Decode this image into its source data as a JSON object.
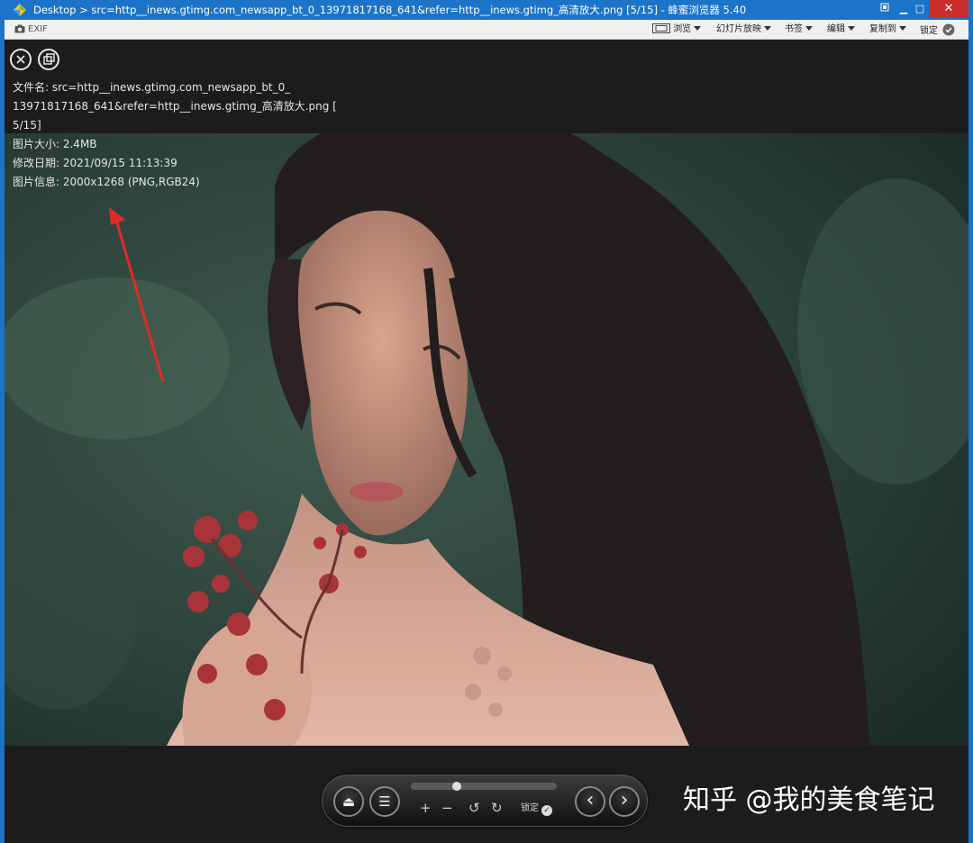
{
  "window": {
    "title": "Desktop > src=http__inews.gtimg.com_newsapp_bt_0_13971817168_641&refer=http__inews.gtimg_高清放大.png [5/15] - 蜂蜜浏览器 5.40",
    "min_label": "▁",
    "max_label": "□",
    "close_label": "✕"
  },
  "toolbar": {
    "exif_label": "EXIF",
    "browse_label": "浏览",
    "slideshow_label": "幻灯片放映",
    "bookmark_label": "书签",
    "edit_label": "编辑",
    "copyto_label": "复制到",
    "lock_label": "锁定"
  },
  "info": {
    "filename_line1": "文件名: src=http__inews.gtimg.com_newsapp_bt_0_",
    "filename_line2": "13971817168_641&refer=http__inews.gtimg_高清放大.png [",
    "filename_line3": "5/15]",
    "size": "图片大小: 2.4MB",
    "modified": "修改日期: 2021/09/15 11:13:39",
    "details": "图片信息: 2000x1268 (PNG,RGB24)"
  },
  "controls": {
    "eject_icon": "⏏",
    "menu_icon": "☰",
    "zoom_in": "+",
    "zoom_out": "−",
    "rotate_left": "↺",
    "rotate_right": "↻",
    "lock_label": "锁定",
    "prev_icon": "‹",
    "next_icon": "›",
    "slider_position": 0.3
  },
  "watermark": "知乎 @我的美食笔记"
}
